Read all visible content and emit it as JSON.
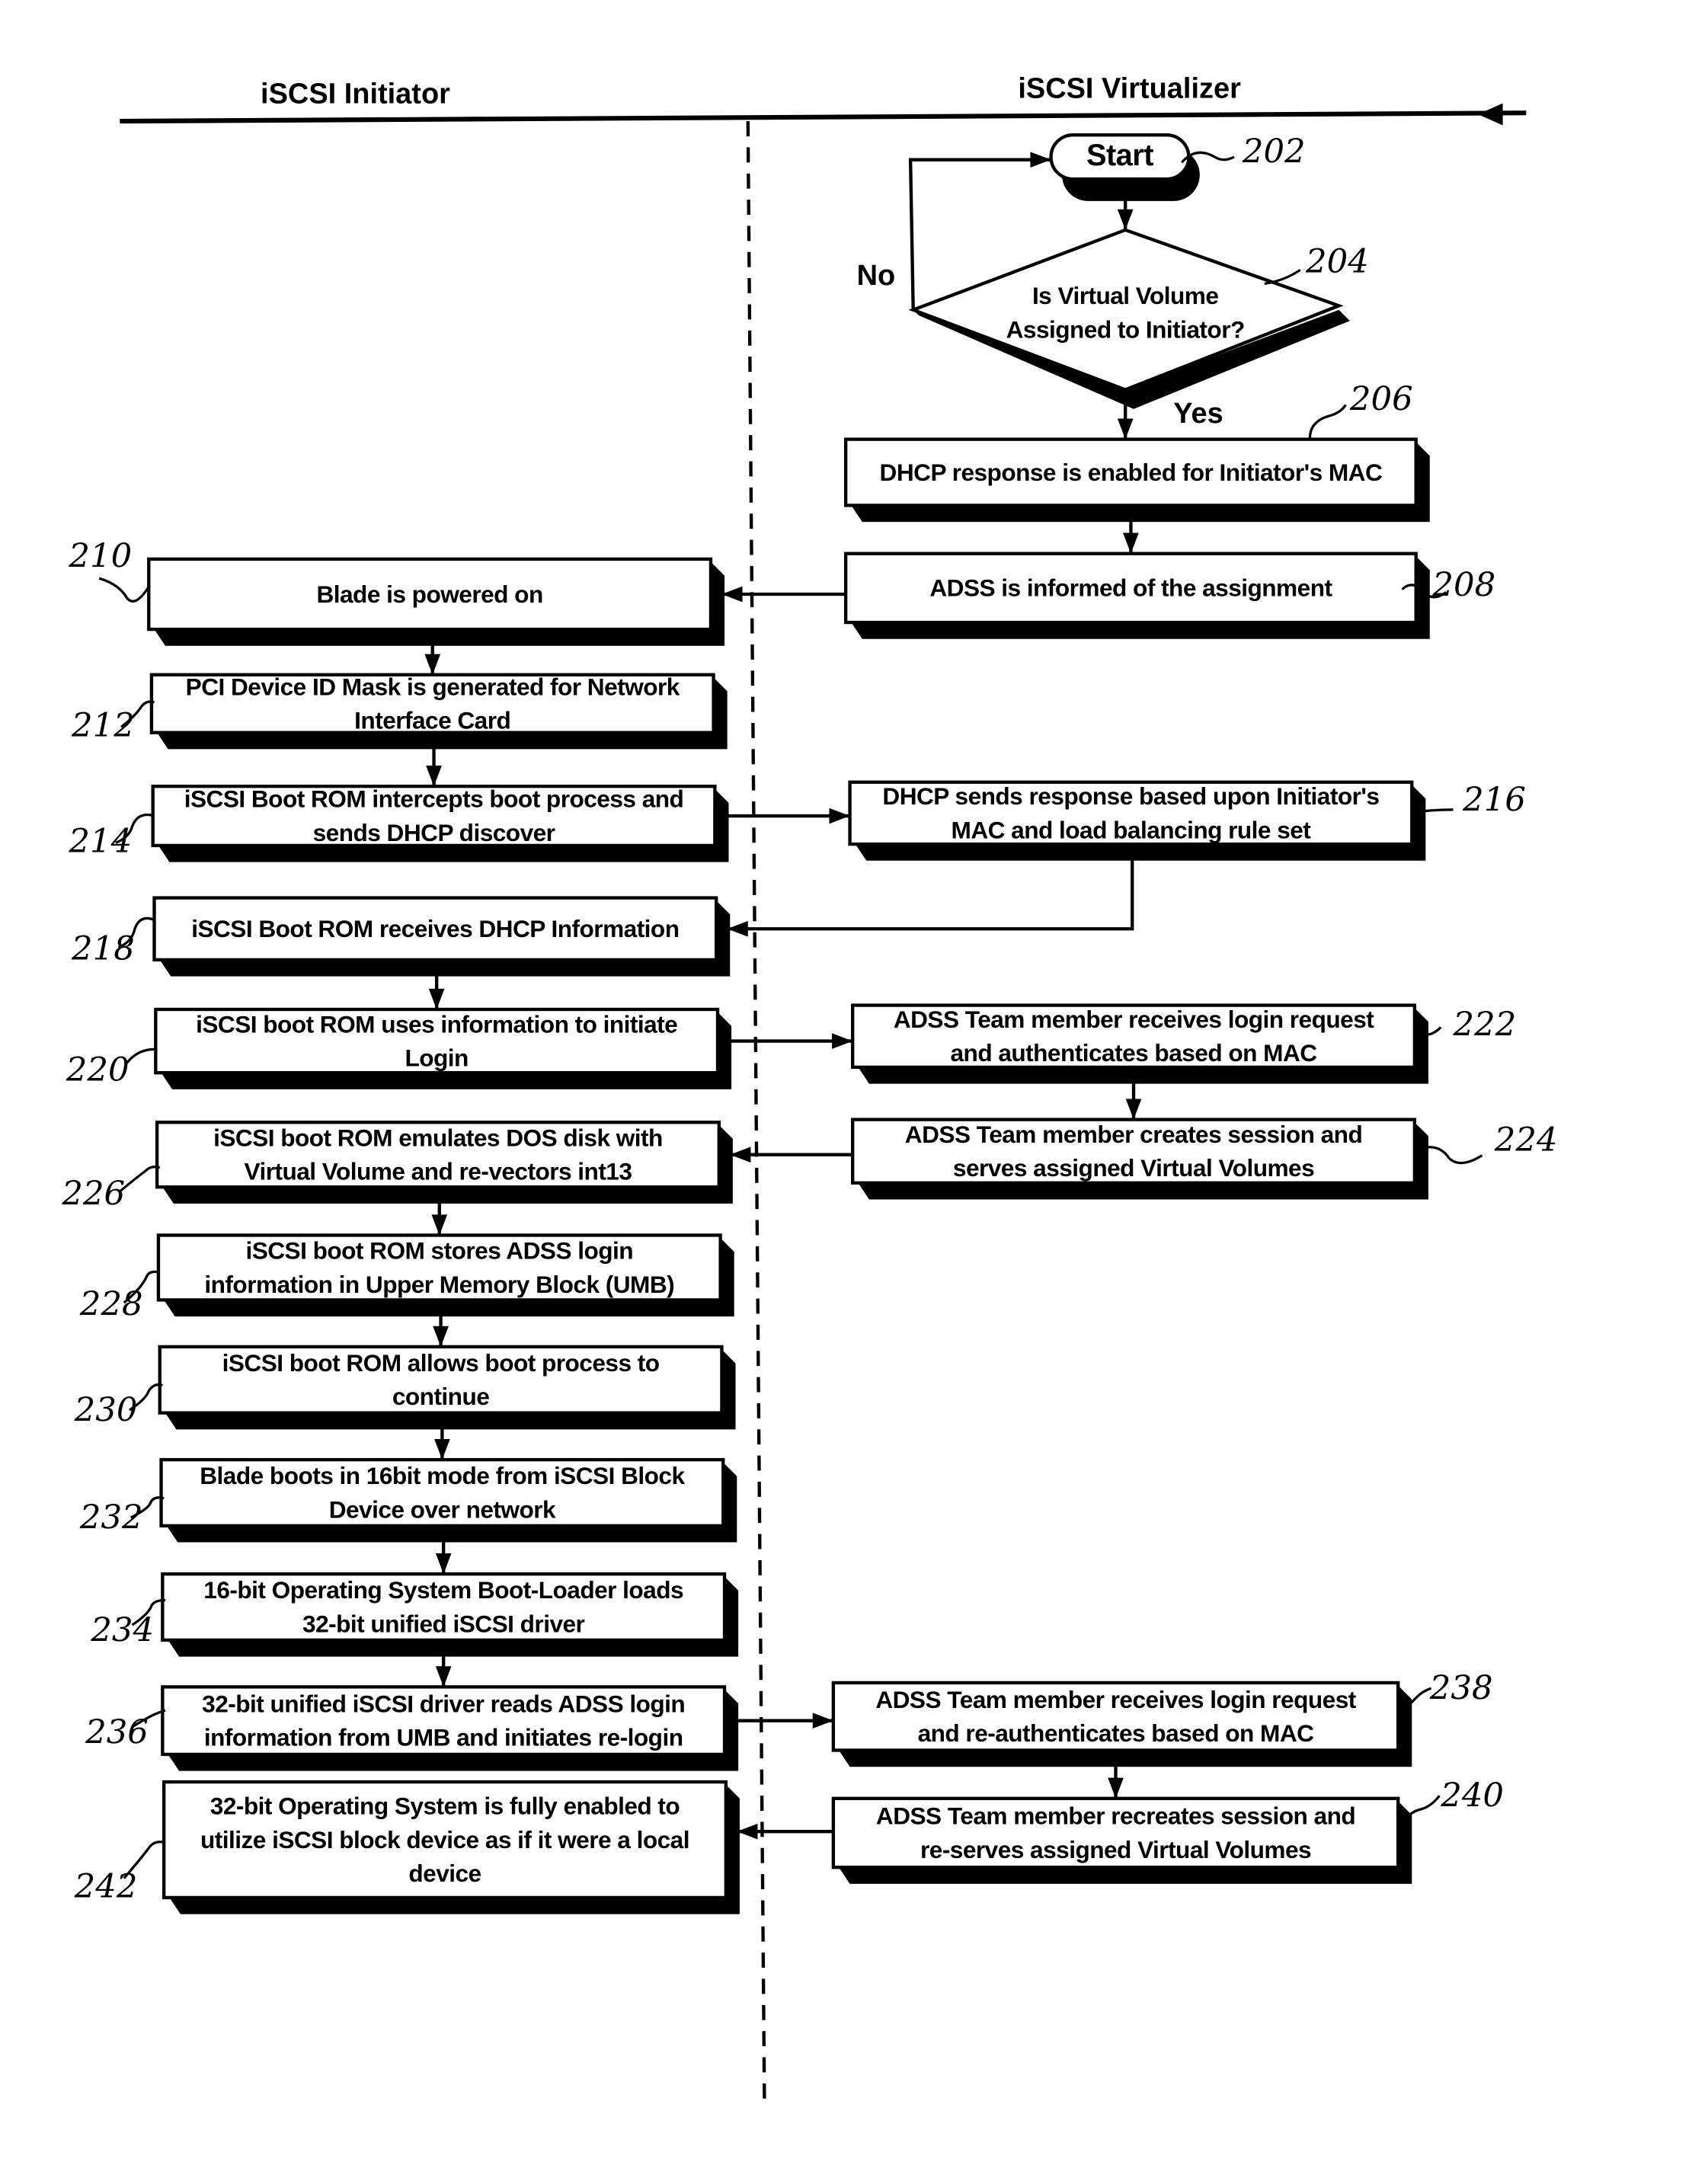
{
  "lanes": {
    "initiator_title": "iSCSI Initiator",
    "virtualizer_title": "iSCSI Virtualizer"
  },
  "decision_labels": {
    "no": "No",
    "yes": "Yes"
  },
  "steps": [
    {
      "id": "202",
      "lane": "virtualizer",
      "shape": "terminal",
      "lines": [
        "Start"
      ]
    },
    {
      "id": "204",
      "lane": "virtualizer",
      "shape": "decision",
      "lines": [
        "Is Virtual Volume",
        "Assigned to Initiator?"
      ]
    },
    {
      "id": "206",
      "lane": "virtualizer",
      "shape": "process",
      "lines": [
        "DHCP response is enabled for Initiator's MAC"
      ]
    },
    {
      "id": "208",
      "lane": "virtualizer",
      "shape": "process",
      "lines": [
        "ADSS is informed of the assignment"
      ]
    },
    {
      "id": "210",
      "lane": "initiator",
      "shape": "process",
      "lines": [
        "Blade is powered on"
      ]
    },
    {
      "id": "212",
      "lane": "initiator",
      "shape": "process",
      "lines": [
        "PCI Device ID Mask is generated for Network",
        "Interface Card"
      ]
    },
    {
      "id": "214",
      "lane": "initiator",
      "shape": "process",
      "lines": [
        "iSCSI Boot ROM intercepts boot process and",
        "sends DHCP discover"
      ]
    },
    {
      "id": "216",
      "lane": "virtualizer",
      "shape": "process",
      "lines": [
        "DHCP sends response based upon Initiator's",
        "MAC and load balancing rule set"
      ]
    },
    {
      "id": "218",
      "lane": "initiator",
      "shape": "process",
      "lines": [
        "iSCSI Boot ROM receives DHCP Information"
      ]
    },
    {
      "id": "220",
      "lane": "initiator",
      "shape": "process",
      "lines": [
        "iSCSI boot ROM uses information to initiate",
        "Login"
      ]
    },
    {
      "id": "222",
      "lane": "virtualizer",
      "shape": "process",
      "lines": [
        "ADSS Team member receives login request",
        "and authenticates based on MAC"
      ]
    },
    {
      "id": "224",
      "lane": "virtualizer",
      "shape": "process",
      "lines": [
        "ADSS Team member creates session and",
        "serves assigned Virtual Volumes"
      ]
    },
    {
      "id": "226",
      "lane": "initiator",
      "shape": "process",
      "lines": [
        "iSCSI boot ROM emulates DOS disk with",
        "Virtual Volume and re-vectors int13"
      ]
    },
    {
      "id": "228",
      "lane": "initiator",
      "shape": "process",
      "lines": [
        "iSCSI boot ROM stores ADSS login",
        "information in Upper Memory Block (UMB)"
      ]
    },
    {
      "id": "230",
      "lane": "initiator",
      "shape": "process",
      "lines": [
        "iSCSI boot ROM allows boot process to",
        "continue"
      ]
    },
    {
      "id": "232",
      "lane": "initiator",
      "shape": "process",
      "lines": [
        "Blade boots in 16bit mode from iSCSI Block",
        "Device over network"
      ]
    },
    {
      "id": "234",
      "lane": "initiator",
      "shape": "process",
      "lines": [
        "16-bit Operating System Boot-Loader loads",
        "32-bit unified iSCSI driver"
      ]
    },
    {
      "id": "236",
      "lane": "initiator",
      "shape": "process",
      "lines": [
        "32-bit unified iSCSI driver reads ADSS login",
        "information from UMB and initiates re-login"
      ]
    },
    {
      "id": "238",
      "lane": "virtualizer",
      "shape": "process",
      "lines": [
        "ADSS Team member receives login request",
        "and re-authenticates based on MAC"
      ]
    },
    {
      "id": "240",
      "lane": "virtualizer",
      "shape": "process",
      "lines": [
        "ADSS Team member recreates session and",
        "re-serves assigned Virtual Volumes"
      ]
    },
    {
      "id": "242",
      "lane": "initiator",
      "shape": "process",
      "lines": [
        "32-bit Operating System is fully enabled to",
        "utilize iSCSI block device as if it were a local",
        "device"
      ]
    }
  ],
  "connections": [
    {
      "from": "202",
      "to": "204"
    },
    {
      "from": "204",
      "to": "206",
      "label": "Yes"
    },
    {
      "from": "204",
      "to": "202",
      "label": "No"
    },
    {
      "from": "206",
      "to": "208"
    },
    {
      "from": "208",
      "to": "210"
    },
    {
      "from": "210",
      "to": "212"
    },
    {
      "from": "212",
      "to": "214"
    },
    {
      "from": "214",
      "to": "216"
    },
    {
      "from": "216",
      "to": "218"
    },
    {
      "from": "218",
      "to": "220"
    },
    {
      "from": "220",
      "to": "222"
    },
    {
      "from": "222",
      "to": "224"
    },
    {
      "from": "224",
      "to": "226"
    },
    {
      "from": "226",
      "to": "228"
    },
    {
      "from": "228",
      "to": "230"
    },
    {
      "from": "230",
      "to": "232"
    },
    {
      "from": "232",
      "to": "234"
    },
    {
      "from": "234",
      "to": "236"
    },
    {
      "from": "236",
      "to": "238"
    },
    {
      "from": "238",
      "to": "240"
    },
    {
      "from": "240",
      "to": "242"
    }
  ]
}
